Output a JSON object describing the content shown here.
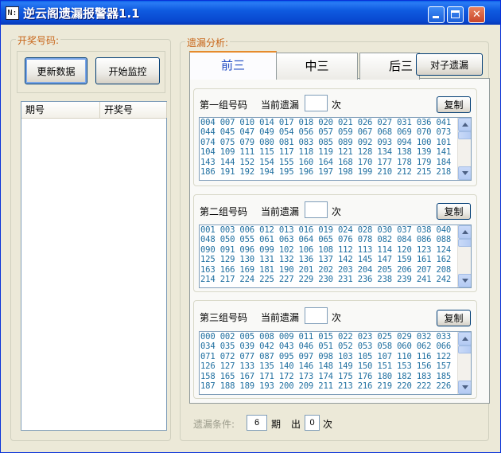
{
  "window": {
    "title": "逆云阁遗漏报警器1.1",
    "icon_text": "N:"
  },
  "left": {
    "group_title": "开奖号码:",
    "update_button": "更新数据",
    "monitor_button": "开始监控",
    "columns": [
      "期号",
      "开奖号"
    ]
  },
  "right": {
    "group_title": "遗漏分析:",
    "tabs": [
      "前三",
      "中三",
      "后三"
    ],
    "pair_button": "对子遗漏",
    "groups": [
      {
        "label": "第一组号码",
        "current_label": "当前遗漏",
        "current_value": "",
        "unit": "次",
        "copy": "复制",
        "numbers": "004 007 010 014 017 018 020 021 026 027 031 036 041\n044 045 047 049 054 056 057 059 067 068 069 070 073\n074 075 079 080 081 083 085 089 092 093 094 100 101\n104 109 111 115 117 118 119 121 128 134 138 139 141\n143 144 152 154 155 160 164 168 170 177 178 179 184\n186 191 192 194 195 196 197 198 199 210 212 215 218"
      },
      {
        "label": "第二组号码",
        "current_label": "当前遗漏",
        "current_value": "",
        "unit": "次",
        "copy": "复制",
        "numbers": "001 003 006 012 013 016 019 024 028 030 037 038 040\n048 050 055 061 063 064 065 076 078 082 084 086 088\n090 091 096 099 102 106 108 112 113 114 120 123 124\n125 129 130 131 132 136 137 142 145 147 159 161 162\n163 166 169 181 190 201 202 203 204 205 206 207 208\n214 217 224 225 227 229 230 231 236 238 239 241 242"
      },
      {
        "label": "第三组号码",
        "current_label": "当前遗漏",
        "current_value": "",
        "unit": "次",
        "copy": "复制",
        "numbers": "000 002 005 008 009 011 015 022 023 025 029 032 033\n034 035 039 042 043 046 051 052 053 058 060 062 066\n071 072 077 087 095 097 098 103 105 107 110 116 122\n126 127 133 135 140 146 148 149 150 151 153 156 157\n158 165 167 171 172 173 174 175 176 180 182 183 185\n187 188 189 193 200 209 211 213 216 219 220 222 226"
      }
    ],
    "condition_label": "遗漏条件:",
    "periods_value": "6",
    "periods_unit": "期",
    "out_label": "出",
    "out_value": "0",
    "out_unit": "次"
  }
}
